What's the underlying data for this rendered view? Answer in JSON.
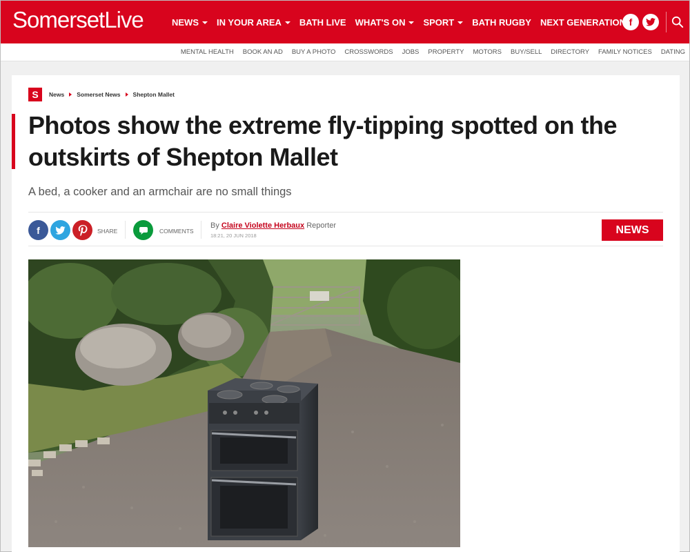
{
  "header": {
    "logo_bold": "Somerset",
    "logo_light": "Live",
    "nav": [
      {
        "label": "NEWS",
        "dropdown": true
      },
      {
        "label": "IN YOUR AREA",
        "dropdown": true
      },
      {
        "label": "BATH LIVE",
        "dropdown": false
      },
      {
        "label": "WHAT'S ON",
        "dropdown": true
      },
      {
        "label": "SPORT",
        "dropdown": true
      },
      {
        "label": "BATH RUGBY",
        "dropdown": false
      },
      {
        "label": "NEXT GENERATION",
        "dropdown": false
      }
    ],
    "facebook_glyph": "f",
    "twitter_icon": "twitter-icon",
    "search_icon": "search-icon"
  },
  "subnav": [
    "MENTAL HEALTH",
    "BOOK AN AD",
    "BUY A PHOTO",
    "CROSSWORDS",
    "JOBS",
    "PROPERTY",
    "MOTORS",
    "BUY/SELL",
    "DIRECTORY",
    "FAMILY NOTICES",
    "DATING"
  ],
  "breadcrumb": {
    "logo_letter": "S",
    "items": [
      "News",
      "Somerset News",
      "Shepton Mallet"
    ]
  },
  "article": {
    "headline": "Photos show the extreme fly-tipping spotted on the outskirts of Shepton Mallet",
    "standfirst": "A bed, a cooker and an armchair are no small things",
    "share_label": "SHARE",
    "comments_label": "COMMENTS",
    "by_prefix": "By",
    "author": "Claire Violette Herbaux",
    "role": "Reporter",
    "timestamp": "18:21, 20 JUN 2018",
    "category_badge": "NEWS"
  },
  "colors": {
    "brand_red": "#d8041d",
    "facebook": "#3b5998",
    "twitter": "#2fa5e0",
    "pinterest": "#cb2027",
    "comments": "#0a9b3c"
  }
}
